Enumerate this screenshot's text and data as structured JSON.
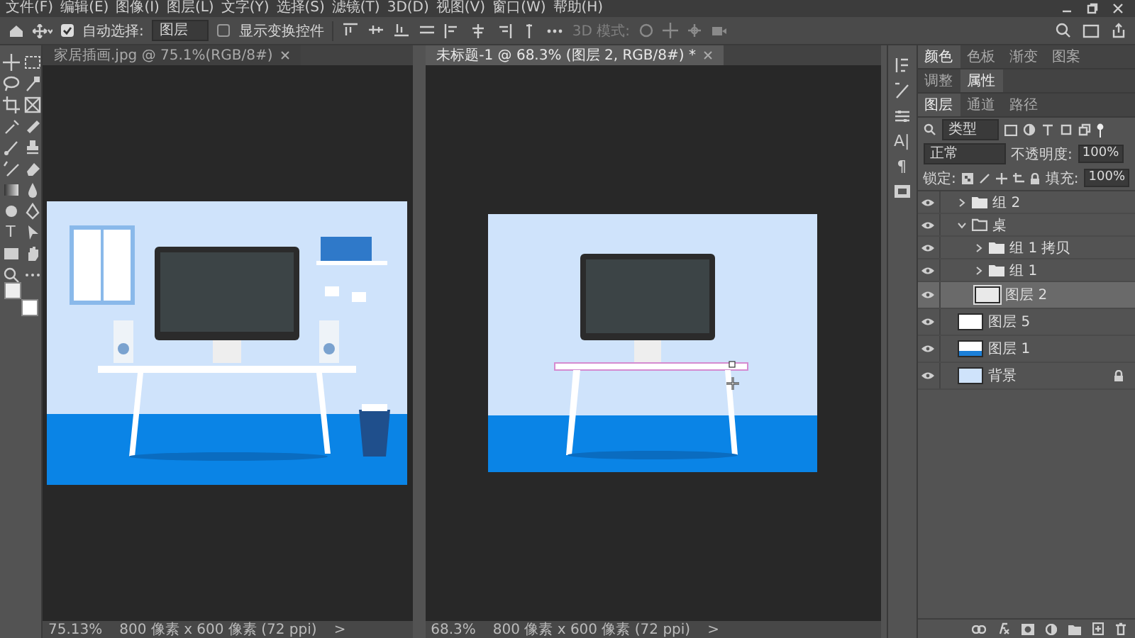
{
  "menu": [
    "文件(F)",
    "编辑(E)",
    "图像(I)",
    "图层(L)",
    "文字(Y)",
    "选择(S)",
    "滤镜(T)",
    "3D(D)",
    "视图(V)",
    "窗口(W)",
    "帮助(H)"
  ],
  "options_bar": {
    "auto_select": {
      "label": "自动选择:",
      "checked": true
    },
    "auto_select_target": "图层",
    "show_transform": {
      "label": "显示变换控件",
      "checked": false
    },
    "mode_3d": {
      "label": "3D 模式:",
      "disabled": true
    }
  },
  "toolbar": {
    "text_tool": "T"
  },
  "dock": {
    "glyphs": [
      "A|",
      "¶"
    ]
  },
  "documents": [
    {
      "title": "家居插画.jpg @ 75.1%(RGB/8#)",
      "selected": false,
      "kind": "room",
      "zoom": "75.13%",
      "size": "800 像素 x 600 像素 (72 ppi)",
      "arrow": ">"
    },
    {
      "title": "未标题-1 @ 68.3% (图层 2, RGB/8#) *",
      "selected": true,
      "kind": "editing",
      "zoom": "68.3%",
      "size": "800 像素 x 600 像素 (72 ppi)",
      "arrow": ">"
    }
  ],
  "panel_groups": [
    {
      "tabs": [
        {
          "label": "颜色",
          "selected": true
        },
        {
          "label": "色板",
          "selected": false
        },
        {
          "label": "渐变",
          "selected": false
        },
        {
          "label": "图案",
          "selected": false
        }
      ]
    },
    {
      "tabs": [
        {
          "label": "调整",
          "selected": false
        },
        {
          "label": "属性",
          "selected": true
        }
      ]
    },
    {
      "tabs": [
        {
          "label": "图层",
          "selected": true
        },
        {
          "label": "通道",
          "selected": false
        },
        {
          "label": "路径",
          "selected": false
        }
      ]
    }
  ],
  "layers": {
    "filter": "类型",
    "blend": "正常",
    "opacity_label": "不透明度:",
    "opacity": "100%",
    "lock_label": "锁定:",
    "fill_label": "填充:",
    "fill": "100%",
    "items": [
      {
        "name": "组 2",
        "kind": "group",
        "expanded": false,
        "visible": true,
        "selected": false
      },
      {
        "name": "桌",
        "kind": "group",
        "expanded": true,
        "visible": true,
        "selected": false,
        "children": [
          {
            "name": "组 1 拷贝",
            "kind": "group",
            "expanded": false,
            "visible": true,
            "selected": false
          },
          {
            "name": "组 1",
            "kind": "group",
            "expanded": false,
            "visible": true,
            "selected": false
          },
          {
            "name": "图层 2",
            "kind": "layer",
            "visible": true,
            "selected": true,
            "locked": false
          }
        ]
      },
      {
        "name": "图层 5",
        "kind": "layer",
        "visible": true,
        "selected": false,
        "locked": false
      },
      {
        "name": "图层 1",
        "kind": "layer",
        "visible": true,
        "selected": false,
        "locked": false
      },
      {
        "name": "背景",
        "kind": "layer",
        "visible": true,
        "selected": false,
        "locked": true
      }
    ]
  }
}
